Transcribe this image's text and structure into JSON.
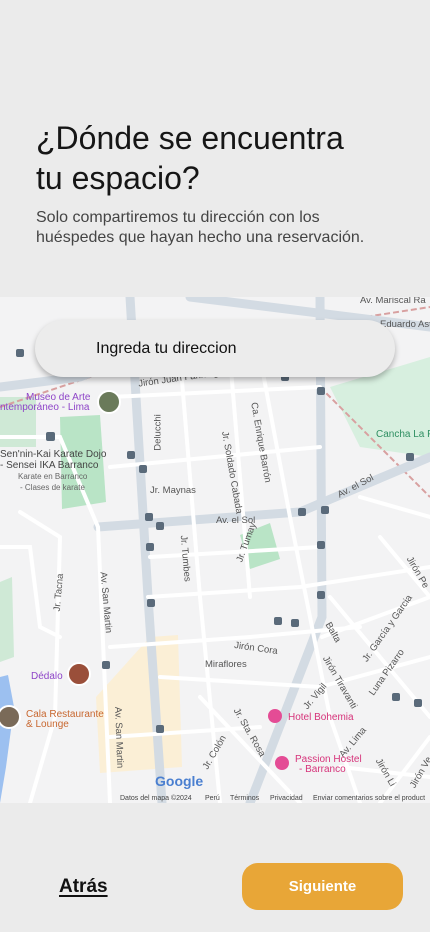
{
  "header": {
    "title_line1": "¿Dónde se encuentra",
    "title_line2": "tu espacio?",
    "subtitle_line1": "Solo compartiremos tu dirección con los",
    "subtitle_line2": "huéspedes que hayan hecho una reservación."
  },
  "address_input": {
    "placeholder": "Ingreda tu direccion",
    "value": ""
  },
  "map": {
    "streets": {
      "av_mariscal": "Av. Mariscal Ra",
      "eduardo": "Eduardo Aste",
      "jiron_juan_fanning": "Jirón Juan Fanning",
      "delucchi": "Delucchi",
      "enrique_barron": "Ca. Enrique Barrón",
      "soldado_cabada": "Jr. Soldado Cabada",
      "jr_maynas": "Jr. Maynas",
      "av_el_sol_1": "Av. el Sol",
      "av_el_sol_2": "Av. el Sol",
      "jr_tumbes": "Jr. Tumbes",
      "jr_tumay": "Jr. Tumay",
      "jr_tacna": "Jr. Tacna",
      "av_san_martin_1": "Av. San Martin",
      "av_san_martin_2": "Av. San Martin",
      "jiron_cora": "Jirón Cora",
      "miraflores": "Miraflores",
      "balta": "Balta",
      "jr_garcia": "Jr. García y Garcia",
      "jiron_pedro": "Jirón Pe",
      "jiron_tiravanti": "Jirón Tiravanti",
      "luna_pizarro": "Luna Pizarro",
      "jr_vigil": "Jr. Vigil",
      "jr_sta_rosa": "Jr. Sta. Rosa",
      "jr_colon": "Jr. Colón",
      "av_lima": "Av. Lima",
      "jiron_lima": "Jirón Li",
      "jiron_ve": "Jirón Ve"
    },
    "pois": {
      "museo_line1": "Museo de Arte",
      "museo_line2": "ntemporáneo - Lima",
      "karate_line1": "Sen'nin-Kai Karate Dojo",
      "karate_line2": "- Sensei IKA Barranco",
      "karate_line3": "Karate en Barranco",
      "karate_line4": "- Clases de karate",
      "cancha": "Cancha La F",
      "dedalo": "Dédalo",
      "cala_line1": "Cala Restaurante",
      "cala_line2": "& Lounge",
      "bohemia": "Hotel Bohemia",
      "passion_line1": "Passion Hostel",
      "passion_line2": "- Barranco"
    },
    "google_logo": "Google",
    "attribution": {
      "data": "Datos del mapa ©2024",
      "country": "Perú",
      "terms": "Términos",
      "privacy": "Privacidad",
      "feedback": "Enviar comentarios sobre el product"
    },
    "colors": {
      "background": "#f3f3f4",
      "road": "#ffffff",
      "road_major": "#d3dbe3",
      "park": "#b9e4c6",
      "water": "#9cc0f0",
      "rail": "#d8a0a0"
    }
  },
  "footer": {
    "back_label": "Atrás",
    "next_label": "Siguiente"
  },
  "colors": {
    "page_background": "#ebebeb",
    "accent": "#e8a637"
  }
}
